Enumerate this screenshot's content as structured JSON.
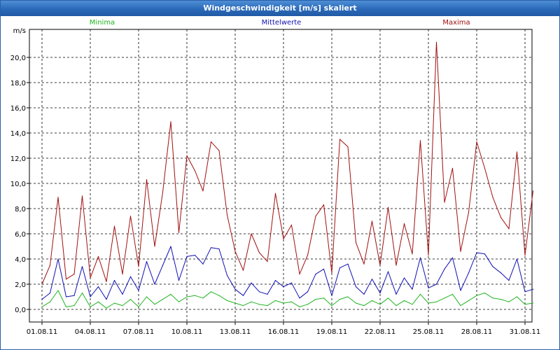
{
  "window": {
    "title": "Windgeschwindigkeit [m/s] skaliert"
  },
  "chart_data": {
    "type": "line",
    "title": "Windgeschwindigkeit [m/s] skaliert",
    "ylabel": "m/s",
    "ylim": [
      0,
      22
    ],
    "xlim": [
      0,
      30.7
    ],
    "yticks": [
      "0,0",
      "2,0",
      "4,0",
      "6,0",
      "8,0",
      "10,0",
      "12,0",
      "14,0",
      "16,0",
      "18,0",
      "20,0"
    ],
    "ytick_values": [
      0,
      2,
      4,
      6,
      8,
      10,
      12,
      14,
      16,
      18,
      20
    ],
    "xticks": [
      "01.08.11",
      "04.08.11",
      "07.08.11",
      "10.08.11",
      "13.08.11",
      "16.08.11",
      "19.08.11",
      "22.08.11",
      "25.08.11",
      "28.08.11",
      "31.08.11"
    ],
    "xtick_days": [
      0,
      3,
      6,
      9,
      12,
      15,
      18,
      21,
      24,
      27,
      30
    ],
    "grid": true,
    "legend_position": "top",
    "series": [
      {
        "name": "Minima",
        "color": "#22b422",
        "x": [
          0,
          0.5,
          1,
          1.5,
          2,
          2.5,
          3,
          3.5,
          4,
          4.5,
          5,
          5.5,
          6,
          6.5,
          7,
          7.5,
          8,
          8.5,
          9,
          9.5,
          10,
          10.5,
          11,
          11.5,
          12,
          12.5,
          13,
          13.5,
          14,
          14.5,
          15,
          15.5,
          16,
          16.5,
          17,
          17.5,
          18,
          18.5,
          19,
          19.5,
          20,
          20.5,
          21,
          21.5,
          22,
          22.5,
          23,
          23.5,
          24,
          24.5,
          25,
          25.5,
          26,
          26.5,
          27,
          27.5,
          28,
          28.5,
          29,
          29.5,
          30,
          30.5
        ],
        "values": [
          0.2,
          0.6,
          1.5,
          0.2,
          0.3,
          1.3,
          0.2,
          0.6,
          0.1,
          0.5,
          0.3,
          0.8,
          0.2,
          1.0,
          0.4,
          0.8,
          1.2,
          0.6,
          1.0,
          1.1,
          0.9,
          1.4,
          1.1,
          0.7,
          0.5,
          0.3,
          0.6,
          0.4,
          0.3,
          0.7,
          0.5,
          0.6,
          0.2,
          0.4,
          0.8,
          0.9,
          0.3,
          0.8,
          1.0,
          0.5,
          0.3,
          0.7,
          0.4,
          0.9,
          0.3,
          0.7,
          0.4,
          1.2,
          0.5,
          0.6,
          0.9,
          1.2,
          0.3,
          0.7,
          1.1,
          1.3,
          0.9,
          0.8,
          0.6,
          1.0,
          0.4,
          0.5
        ]
      },
      {
        "name": "Mittelwerte",
        "color": "#1010b4",
        "x": [
          0,
          0.5,
          1,
          1.5,
          2,
          2.5,
          3,
          3.5,
          4,
          4.5,
          5,
          5.5,
          6,
          6.5,
          7,
          7.5,
          8,
          8.5,
          9,
          9.5,
          10,
          10.5,
          11,
          11.5,
          12,
          12.5,
          13,
          13.5,
          14,
          14.5,
          15,
          15.5,
          16,
          16.5,
          17,
          17.5,
          18,
          18.5,
          19,
          19.5,
          20,
          20.5,
          21,
          21.5,
          22,
          22.5,
          23,
          23.5,
          24,
          24.5,
          25,
          25.5,
          26,
          26.5,
          27,
          27.5,
          28,
          28.5,
          29,
          29.5,
          30,
          30.5
        ],
        "values": [
          0.8,
          1.3,
          4.0,
          1.0,
          1.1,
          3.4,
          1.0,
          1.8,
          0.8,
          2.3,
          1.2,
          2.6,
          1.5,
          3.8,
          2.0,
          3.5,
          5.0,
          2.3,
          4.2,
          4.3,
          3.6,
          4.9,
          4.8,
          2.7,
          1.6,
          1.1,
          2.1,
          1.4,
          1.2,
          2.3,
          1.8,
          2.1,
          0.9,
          1.4,
          2.8,
          3.2,
          1.1,
          3.3,
          3.6,
          1.8,
          1.2,
          2.4,
          1.3,
          3.0,
          1.2,
          2.5,
          1.6,
          4.1,
          1.7,
          2.0,
          3.2,
          4.1,
          1.5,
          2.9,
          4.5,
          4.4,
          3.4,
          2.9,
          2.3,
          4.0,
          1.4,
          1.6
        ]
      },
      {
        "name": "Maxima",
        "color": "#a01010",
        "x": [
          0,
          0.5,
          1,
          1.5,
          2,
          2.5,
          3,
          3.5,
          4,
          4.5,
          5,
          5.5,
          6,
          6.5,
          7,
          7.5,
          8,
          8.5,
          9,
          9.5,
          10,
          10.5,
          11,
          11.5,
          12,
          12.5,
          13,
          13.5,
          14,
          14.5,
          15,
          15.5,
          16,
          16.5,
          17,
          17.5,
          18,
          18.5,
          19,
          19.5,
          20,
          20.5,
          21,
          21.5,
          22,
          22.5,
          23,
          23.5,
          24,
          24.5,
          25,
          25.5,
          26,
          26.5,
          27,
          27.5,
          28,
          28.5,
          29,
          29.5,
          30,
          30.5
        ],
        "values": [
          2.0,
          3.5,
          8.9,
          2.4,
          2.8,
          9.0,
          2.5,
          4.2,
          2.2,
          6.6,
          2.8,
          7.4,
          3.4,
          10.3,
          5.0,
          9.3,
          14.9,
          6.1,
          12.2,
          11.0,
          9.4,
          13.3,
          12.6,
          7.5,
          4.6,
          3.1,
          6.0,
          4.5,
          3.8,
          9.2,
          5.6,
          6.7,
          2.8,
          4.3,
          7.4,
          8.3,
          2.9,
          13.5,
          12.9,
          5.3,
          3.6,
          7.0,
          3.5,
          8.1,
          3.5,
          6.8,
          4.4,
          13.4,
          4.3,
          21.2,
          8.5,
          11.2,
          4.6,
          7.7,
          13.3,
          11.2,
          8.9,
          7.3,
          6.4,
          12.5,
          4.3,
          9.4
        ]
      }
    ]
  }
}
